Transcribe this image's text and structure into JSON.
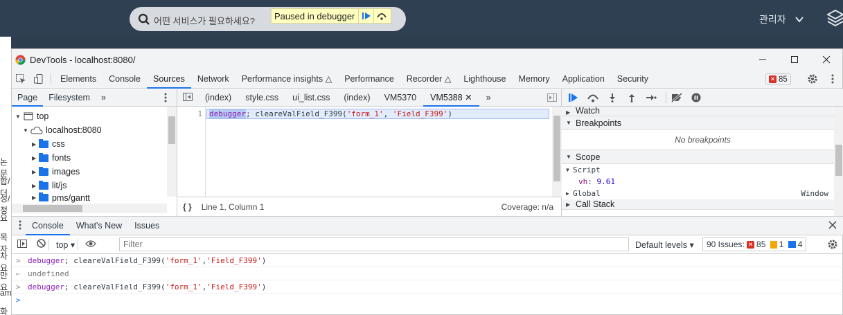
{
  "topbar": {
    "search_placeholder": "어떤 서비스가 필요하세요?",
    "paused_text": "Paused in debugger",
    "admin_label": "관리자"
  },
  "left_strip": [
    "논문",
    "합/더",
    "성/정",
    "요",
    "목자",
    "차요",
    "만 요",
    "am",
    "화"
  ],
  "devtools": {
    "title": "DevTools - localhost:8080/",
    "main_tabs": [
      "Elements",
      "Console",
      "Sources",
      "Network",
      "Performance insights",
      "Performance",
      "Recorder",
      "Lighthouse",
      "Memory",
      "Application",
      "Security"
    ],
    "active_tab": "Sources",
    "error_count": "85"
  },
  "navigator": {
    "tabs": [
      "Page",
      "Filesystem"
    ],
    "tree": [
      {
        "label": "top",
        "depth": 0
      },
      {
        "label": "localhost:8080",
        "depth": 1
      },
      {
        "label": "css",
        "depth": 2
      },
      {
        "label": "fonts",
        "depth": 2
      },
      {
        "label": "images",
        "depth": 2
      },
      {
        "label": "lit/js",
        "depth": 2
      },
      {
        "label": "pms/gantt",
        "depth": 2
      }
    ]
  },
  "editor": {
    "file_tabs": [
      "(index)",
      "style.css",
      "ui_list.css",
      "(index)",
      "VM5370",
      "VM5388"
    ],
    "active_file": "VM5388",
    "line_number": "1",
    "code_kw": "debugger",
    "code_mid": "; cleareValField_F399(",
    "code_arg1": "'form_1'",
    "code_sep": ", ",
    "code_arg2": "'Field_F399'",
    "code_end": ")",
    "position": "Line 1, Column 1",
    "coverage": "Coverage: n/a"
  },
  "debugger": {
    "watch": "Watch",
    "breakpoints": "Breakpoints",
    "no_breakpoints": "No breakpoints",
    "scope": "Scope",
    "script": "Script",
    "var_name": "vh",
    "var_value": "9.61",
    "global": "Global",
    "global_value": "Window",
    "call_stack": "Call Stack"
  },
  "drawer": {
    "tabs": [
      "Console",
      "What's New",
      "Issues"
    ],
    "context": "top",
    "filter_placeholder": "Filter",
    "levels": "Default levels",
    "issues_label": "90 Issues:",
    "issues_errors": "85",
    "issues_warnings": "1",
    "issues_info": "4",
    "lines": [
      {
        "type": "input",
        "kw": "debugger",
        "mid": "; cleareValField_F399(",
        "a1": "'form_1'",
        "sep": ", ",
        "a2": "'Field_F399'",
        "end": ")"
      },
      {
        "type": "output",
        "text": "undefined"
      },
      {
        "type": "input",
        "kw": "debugger",
        "mid": "; cleareValField_F399(",
        "a1": "'form_1'",
        "sep": ", ",
        "a2": "'Field_F399'",
        "end": ")"
      }
    ]
  },
  "colors": {
    "accent": "#1a73e8",
    "topbar": "#2e4052",
    "error": "#d93025"
  }
}
